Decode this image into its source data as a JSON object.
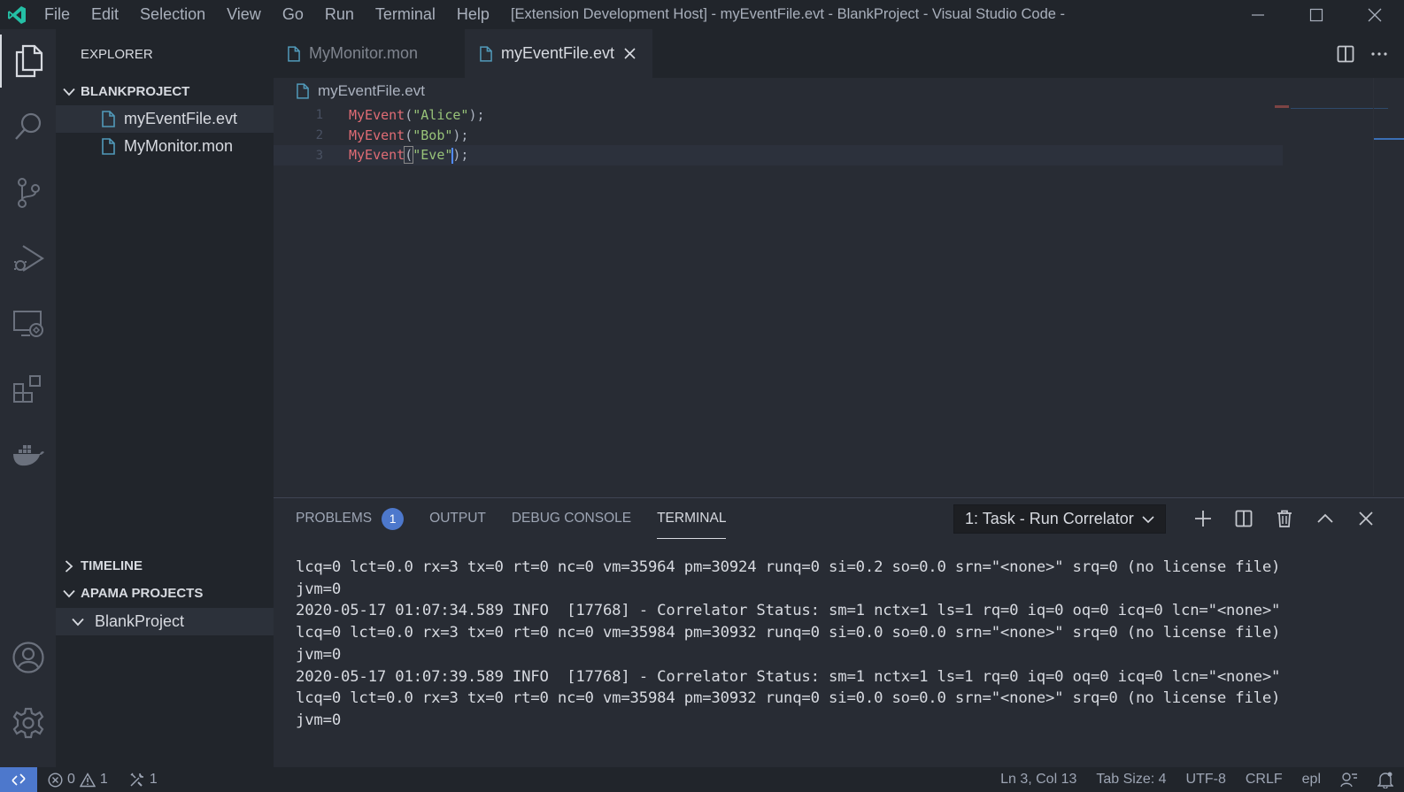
{
  "window": {
    "title": "[Extension Development Host] - myEventFile.evt - BlankProject - Visual Studio Code - Insiders"
  },
  "menu": [
    "File",
    "Edit",
    "Selection",
    "View",
    "Go",
    "Run",
    "Terminal",
    "Help"
  ],
  "activity_bar": [
    "explorer-icon",
    "search-icon",
    "source-control-icon",
    "run-debug-icon",
    "remote-explorer-icon",
    "extensions-icon",
    "docker-icon",
    "account-icon",
    "settings-gear-icon"
  ],
  "sidebar": {
    "title": "EXPLORER",
    "project_section": "BLANKPROJECT",
    "files": [
      "myEventFile.evt",
      "MyMonitor.mon"
    ],
    "timeline_section": "TIMELINE",
    "apama_section": "APAMA PROJECTS",
    "apama_projects": [
      "BlankProject"
    ]
  },
  "tabs": [
    {
      "label": "MyMonitor.mon",
      "active": false
    },
    {
      "label": "myEventFile.evt",
      "active": true
    }
  ],
  "breadcrumb": "myEventFile.evt",
  "editor": {
    "lines": [
      {
        "num": "1",
        "fn": "MyEvent",
        "open": "(",
        "str": "\"Alice\"",
        "close": ");"
      },
      {
        "num": "2",
        "fn": "MyEvent",
        "open": "(",
        "str": "\"Bob\"",
        "close": ");"
      },
      {
        "num": "3",
        "fn": "MyEvent",
        "open": "(",
        "str": "\"Eve\"",
        "close": ");"
      }
    ]
  },
  "panel": {
    "tabs": [
      "PROBLEMS",
      "OUTPUT",
      "DEBUG CONSOLE",
      "TERMINAL"
    ],
    "problems_count": "1",
    "active_tab": "TERMINAL",
    "terminal_select": "1: Task - Run Correlator",
    "terminal_lines": [
      "lcq=0 lct=0.0 rx=3 tx=0 rt=0 nc=0 vm=35964 pm=30924 runq=0 si=0.2 so=0.0 srn=\"<none>\" srq=0 (no license file)",
      "jvm=0",
      "2020-05-17 01:07:34.589 INFO  [17768] - Correlator Status: sm=1 nctx=1 ls=1 rq=0 iq=0 oq=0 icq=0 lcn=\"<none>\"",
      "lcq=0 lct=0.0 rx=3 tx=0 rt=0 nc=0 vm=35984 pm=30932 runq=0 si=0.0 so=0.0 srn=\"<none>\" srq=0 (no license file)",
      "jvm=0",
      "2020-05-17 01:07:39.589 INFO  [17768] - Correlator Status: sm=1 nctx=1 ls=1 rq=0 iq=0 oq=0 icq=0 lcn=\"<none>\"",
      "lcq=0 lct=0.0 rx=3 tx=0 rt=0 nc=0 vm=35984 pm=30932 runq=0 si=0.0 so=0.0 srn=\"<none>\" srq=0 (no license file)",
      "jvm=0"
    ]
  },
  "status": {
    "errors": "0",
    "warnings": "1",
    "ports": "1",
    "position": "Ln 3, Col 13",
    "tab_size": "Tab Size: 4",
    "encoding": "UTF-8",
    "eol": "CRLF",
    "language": "epl"
  },
  "colors": {
    "accent": "#4d78cc",
    "function": "#e06c75",
    "string": "#98c379",
    "file_icon": "#519aba"
  }
}
